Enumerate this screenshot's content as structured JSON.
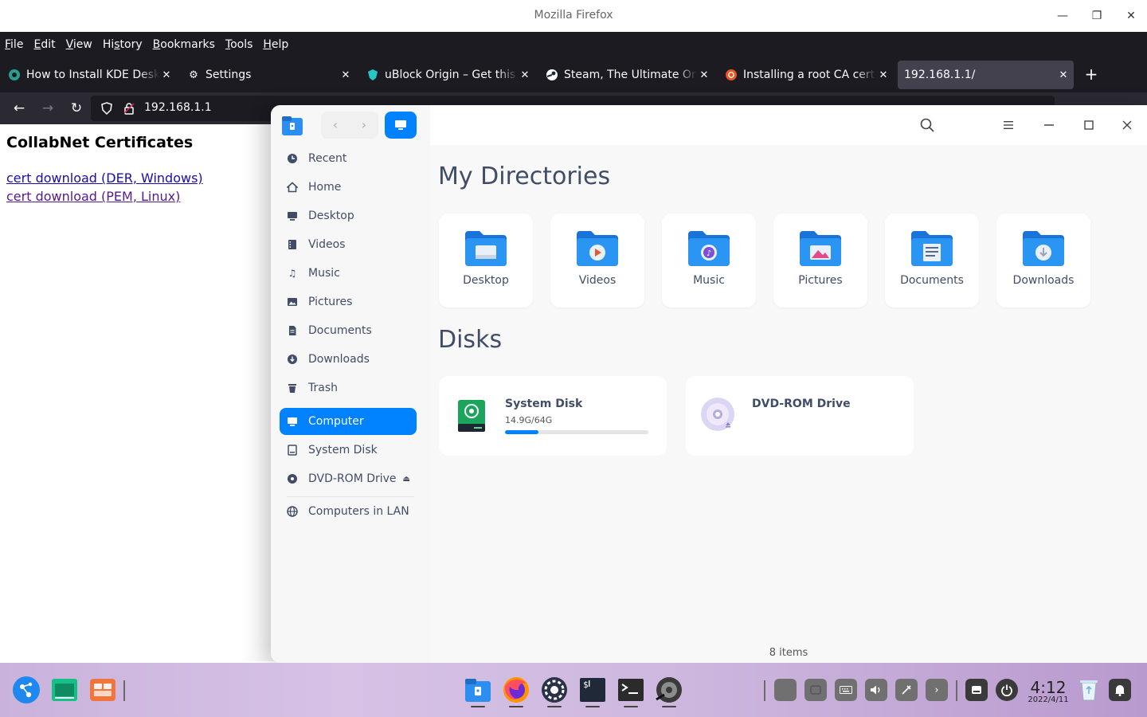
{
  "firefox": {
    "window_title": "Mozilla Firefox",
    "menu": [
      {
        "label": "File",
        "accel": "F",
        "rest": "ile"
      },
      {
        "label": "Edit",
        "accel": "E",
        "rest": "dit"
      },
      {
        "label": "View",
        "accel": "V",
        "rest": "iew"
      },
      {
        "label": "History",
        "pre": "Hi",
        "accel": "s",
        "rest": "tory"
      },
      {
        "label": "Bookmarks",
        "accel": "B",
        "rest": "ookmarks"
      },
      {
        "label": "Tools",
        "accel": "T",
        "rest": "ools"
      },
      {
        "label": "Help",
        "accel": "H",
        "rest": "elp"
      }
    ],
    "tabs": [
      {
        "label": "How to Install KDE Desktop",
        "icon": "kde-icon"
      },
      {
        "label": "Settings",
        "icon": "gear-icon"
      },
      {
        "label": "uBlock Origin – Get this Extension",
        "icon": "ublock-icon"
      },
      {
        "label": "Steam, The Ultimate Online Game Platform",
        "icon": "steam-icon"
      },
      {
        "label": "Installing a root CA certificate",
        "icon": "ubuntu-icon"
      },
      {
        "label": "192.168.1.1/",
        "icon": "",
        "active": true
      }
    ],
    "url": "192.168.1.1"
  },
  "page": {
    "title": "CollabNet Certificates",
    "links": [
      "cert download (DER, Windows)",
      "cert download (PEM, Linux)"
    ]
  },
  "file_manager": {
    "sidebar": [
      {
        "label": "Recent",
        "icon": "clock-icon"
      },
      {
        "label": "Home",
        "icon": "home-icon"
      },
      {
        "label": "Desktop",
        "icon": "desktop-icon"
      },
      {
        "label": "Videos",
        "icon": "video-icon"
      },
      {
        "label": "Music",
        "icon": "music-icon"
      },
      {
        "label": "Pictures",
        "icon": "picture-icon"
      },
      {
        "label": "Documents",
        "icon": "document-icon"
      },
      {
        "label": "Downloads",
        "icon": "download-icon"
      },
      {
        "label": "Trash",
        "icon": "trash-icon"
      },
      {
        "label": "Computer",
        "icon": "computer-icon",
        "active": true
      },
      {
        "label": "System Disk",
        "icon": "disk-icon"
      },
      {
        "label": "DVD-ROM Drive",
        "icon": "dvd-icon"
      },
      {
        "label": "Computers in LAN",
        "icon": "network-icon"
      }
    ],
    "sections": {
      "directories": "My Directories",
      "disks": "Disks"
    },
    "directories": [
      {
        "label": "Desktop",
        "icon": "desktop-folder-icon"
      },
      {
        "label": "Videos",
        "icon": "videos-folder-icon"
      },
      {
        "label": "Music",
        "icon": "music-folder-icon"
      },
      {
        "label": "Pictures",
        "icon": "pictures-folder-icon"
      },
      {
        "label": "Documents",
        "icon": "documents-folder-icon"
      },
      {
        "label": "Downloads",
        "icon": "downloads-folder-icon"
      }
    ],
    "disks": [
      {
        "name": "System Disk",
        "size": "14.9G/64G",
        "usage": 0.233
      },
      {
        "name": "DVD-ROM Drive"
      }
    ],
    "status": "8 items",
    "accent": "#0081ff"
  },
  "taskbar": {
    "time": "4:12",
    "date": "2022/4/11"
  }
}
